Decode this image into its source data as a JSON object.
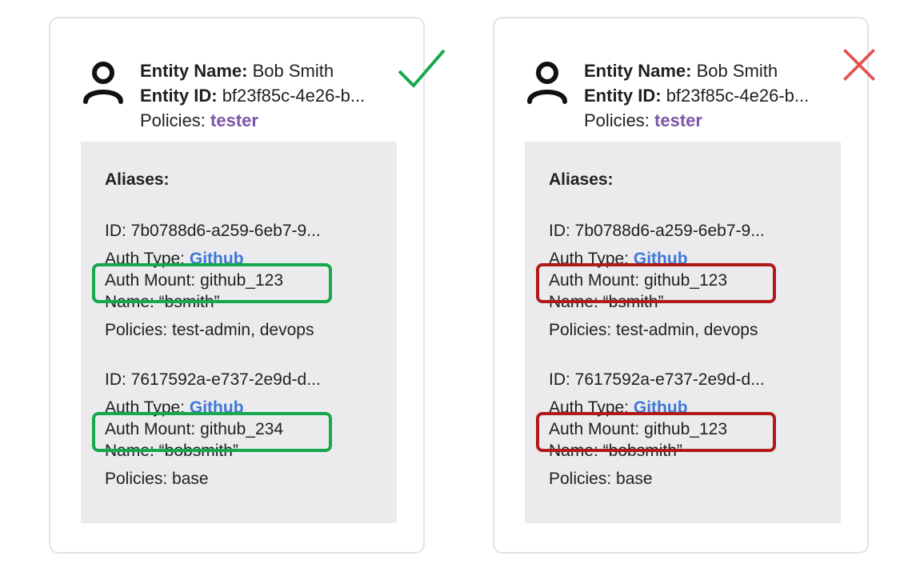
{
  "cards": [
    {
      "status": "correct",
      "mark_icon": "check-icon",
      "mark_color": "#16a84b",
      "highlight_color": "#16a84b",
      "entity_name_label": "Entity Name:",
      "entity_name": "Bob Smith",
      "entity_id_label": "Entity ID:",
      "entity_id": "bf23f85c-4e26-b...",
      "policies_label": "Policies:",
      "policies": "tester",
      "aliases_title": "Aliases:",
      "aliases": [
        {
          "id": "ID: 7b0788d6-a259-6eb7-9...",
          "auth_type_label": "Auth Type:",
          "auth_type": "Github",
          "auth_mount": "Auth Mount: github_123",
          "name": "Name: “bsmith”",
          "policies": "Policies: test-admin, devops"
        },
        {
          "id": "ID: 7617592a-e737-2e9d-d...",
          "auth_type_label": "Auth Type:",
          "auth_type": "Github",
          "auth_mount": "Auth Mount: github_234",
          "name": "Name: “bobsmith”",
          "policies": "Policies: base"
        }
      ]
    },
    {
      "status": "incorrect",
      "mark_icon": "x-icon",
      "mark_color": "#e05353",
      "highlight_color": "#b21a1a",
      "entity_name_label": "Entity Name:",
      "entity_name": "Bob Smith",
      "entity_id_label": "Entity ID:",
      "entity_id": "bf23f85c-4e26-b...",
      "policies_label": "Policies:",
      "policies": "tester",
      "aliases_title": "Aliases:",
      "aliases": [
        {
          "id": "ID: 7b0788d6-a259-6eb7-9...",
          "auth_type_label": "Auth Type:",
          "auth_type": "Github",
          "auth_mount": "Auth Mount: github_123",
          "name": "Name: “bsmith”",
          "policies": "Policies: test-admin, devops"
        },
        {
          "id": "ID: 7617592a-e737-2e9d-d...",
          "auth_type_label": "Auth Type:",
          "auth_type": "Github",
          "auth_mount": "Auth Mount: github_123",
          "name": "Name: “bobsmith”",
          "policies": "Policies: base"
        }
      ]
    }
  ]
}
